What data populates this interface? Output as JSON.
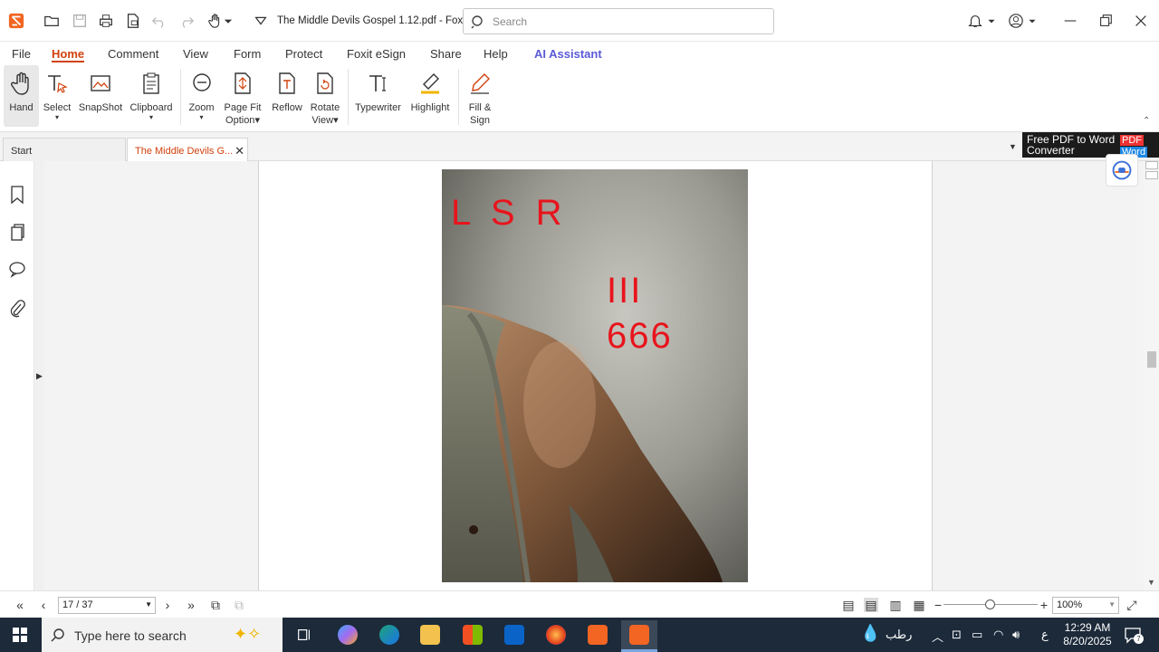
{
  "titlebar": {
    "doc_title": "The Middle Devils Gospel 1.12.pdf - Foxit...",
    "search_placeholder": "Search"
  },
  "menu": {
    "file": "File",
    "home": "Home",
    "comment": "Comment",
    "view": "View",
    "form": "Form",
    "protect": "Protect",
    "esign": "Foxit eSign",
    "share": "Share",
    "help": "Help",
    "ai": "AI Assistant"
  },
  "ribbon": {
    "hand": "Hand",
    "select": "Select",
    "snapshot": "SnapShot",
    "clipboard": "Clipboard",
    "zoom": "Zoom",
    "pagefit_1": "Page Fit",
    "pagefit_2": "Option",
    "reflow": "Reflow",
    "rotate_1": "Rotate",
    "rotate_2": "View",
    "typewriter": "Typewriter",
    "highlight": "Highlight",
    "fill_1": "Fill &",
    "fill_2": "Sign"
  },
  "tabs": {
    "start": "Start",
    "doc": "The Middle Devils G..."
  },
  "promo": {
    "line1": "Free PDF to Word",
    "line2": "Converter",
    "badge_pdf": "PDF",
    "badge_word": "Word"
  },
  "photo": {
    "text_lsr": "L S R",
    "text_iii": "III",
    "text_666": "666"
  },
  "bottombar": {
    "page_value": "17 / 37",
    "zoom_value": "100%"
  },
  "taskbar": {
    "search_text": "Type here to search",
    "weather": "رطب",
    "lang": "ع",
    "time": "12:29 AM",
    "date": "8/20/2025",
    "notif_count": "7"
  },
  "colors": {
    "accent": "#d1410c",
    "ai": "#5a5ad8",
    "taskbar": "#1c2a3a",
    "photo_text": "#e8141c"
  }
}
